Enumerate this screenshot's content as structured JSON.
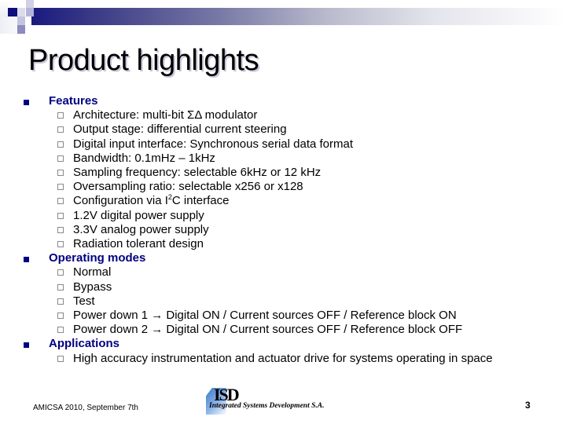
{
  "slide": {
    "title": "Product highlights",
    "sections": [
      {
        "heading": "Features",
        "items": [
          "Architecture: multi-bit ΣΔ modulator",
          "Output stage: differential current steering",
          "Digital input interface: Synchronous serial data format",
          "Bandwidth: 0.1mHz – 1kHz",
          "Sampling frequency: selectable 6kHz or 12 kHz",
          "Oversampling ratio: selectable x256 or x128",
          {
            "pre": "Configuration via I",
            "sup": "2",
            "post": "C interface"
          },
          "1.2V digital power supply",
          "3.3V analog power supply",
          "Radiation tolerant design"
        ]
      },
      {
        "heading": "Operating modes",
        "items": [
          "Normal",
          "Bypass",
          "Test",
          "Power down 1 → Digital ON / Current sources OFF / Reference block ON",
          "Power down 2 → Digital ON / Current sources OFF / Reference block OFF"
        ]
      },
      {
        "heading": "Applications",
        "items": [
          "High accuracy instrumentation and actuator drive for systems operating in space"
        ]
      }
    ]
  },
  "footer": {
    "event": "AMICSA 2010, September 7th",
    "logo_mark": "ISD",
    "logo_company": "Integrated Systems Development S.A.",
    "page_number": "3"
  },
  "icons": {
    "level1_bullet": "filled-square-bullet-icon",
    "level2_bullet": "hollow-square-bullet-icon"
  },
  "colors": {
    "heading_color": "#000080",
    "banner_start": "#1a1a80",
    "banner_end": "#ffffff"
  }
}
